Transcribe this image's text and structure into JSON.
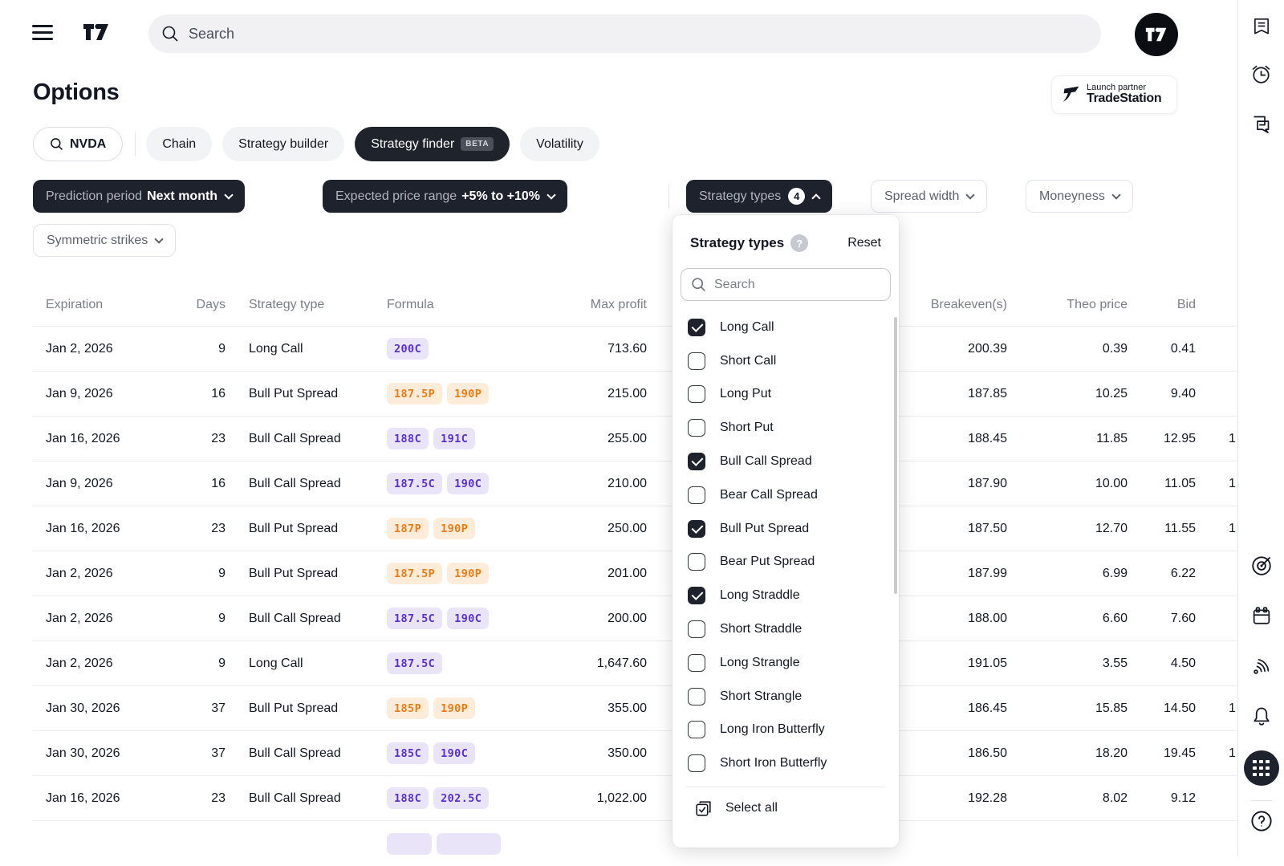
{
  "topbar": {
    "search_placeholder": "Search"
  },
  "page": {
    "title": "Options"
  },
  "partner_badge": {
    "line1": "Launch partner",
    "line2": "TradeStation"
  },
  "symbol_button": {
    "label": "NVDA"
  },
  "tabs": [
    {
      "label": "Chain",
      "active": false
    },
    {
      "label": "Strategy builder",
      "active": false
    },
    {
      "label": "Strategy finder",
      "beta": "BETA",
      "active": true
    },
    {
      "label": "Volatility",
      "active": false
    }
  ],
  "filters": {
    "prediction_period": {
      "label": "Prediction period",
      "value": "Next month"
    },
    "price_range": {
      "label": "Expected price range",
      "value": "+5% to +10%"
    },
    "strategy_types": {
      "label": "Strategy types",
      "count": "4"
    },
    "spread_width": {
      "label": "Spread width"
    },
    "moneyness": {
      "label": "Moneyness"
    },
    "symmetric_strikes": {
      "label": "Symmetric strikes"
    }
  },
  "dropdown": {
    "title": "Strategy types",
    "help_glyph": "?",
    "reset_label": "Reset",
    "search_placeholder": "Search",
    "items": [
      {
        "label": "Long Call",
        "checked": true
      },
      {
        "label": "Short Call",
        "checked": false
      },
      {
        "label": "Long Put",
        "checked": false
      },
      {
        "label": "Short Put",
        "checked": false
      },
      {
        "label": "Bull Call Spread",
        "checked": true
      },
      {
        "label": "Bear Call Spread",
        "checked": false
      },
      {
        "label": "Bull Put Spread",
        "checked": true
      },
      {
        "label": "Bear Put Spread",
        "checked": false
      },
      {
        "label": "Long Straddle",
        "checked": true
      },
      {
        "label": "Short Straddle",
        "checked": false
      },
      {
        "label": "Long Strangle",
        "checked": false
      },
      {
        "label": "Short Strangle",
        "checked": false
      },
      {
        "label": "Long Iron Butterfly",
        "checked": false
      },
      {
        "label": "Short Iron Butterfly",
        "checked": false
      }
    ],
    "select_all_label": "Select all"
  },
  "table": {
    "columns": [
      "Expiration",
      "Days",
      "Strategy type",
      "Formula",
      "Max profit",
      "Breakeven(s)",
      "Theo price",
      "Bid"
    ],
    "rows": [
      {
        "expiration": "Jan 2, 2026",
        "days": "9",
        "strategy": "Long Call",
        "legs": [
          {
            "text": "200C",
            "type": "call"
          }
        ],
        "max_profit": "713.60",
        "breakeven": "200.39",
        "theo": "0.39",
        "bid": "0.41",
        "ask_partial": ""
      },
      {
        "expiration": "Jan 9, 2026",
        "days": "16",
        "strategy": "Bull Put Spread",
        "legs": [
          {
            "text": "187.5P",
            "type": "put"
          },
          {
            "text": "190P",
            "type": "put"
          }
        ],
        "max_profit": "215.00",
        "breakeven": "187.85",
        "theo": "10.25",
        "bid": "9.40",
        "ask_partial": ""
      },
      {
        "expiration": "Jan 16, 2026",
        "days": "23",
        "strategy": "Bull Call Spread",
        "legs": [
          {
            "text": "188C",
            "type": "call"
          },
          {
            "text": "191C",
            "type": "call"
          }
        ],
        "max_profit": "255.00",
        "breakeven": "188.45",
        "theo": "11.85",
        "bid": "12.95",
        "ask_partial": "1"
      },
      {
        "expiration": "Jan 9, 2026",
        "days": "16",
        "strategy": "Bull Call Spread",
        "legs": [
          {
            "text": "187.5C",
            "type": "call"
          },
          {
            "text": "190C",
            "type": "call"
          }
        ],
        "max_profit": "210.00",
        "breakeven": "187.90",
        "theo": "10.00",
        "bid": "11.05",
        "ask_partial": "1"
      },
      {
        "expiration": "Jan 16, 2026",
        "days": "23",
        "strategy": "Bull Put Spread",
        "legs": [
          {
            "text": "187P",
            "type": "put"
          },
          {
            "text": "190P",
            "type": "put"
          }
        ],
        "max_profit": "250.00",
        "breakeven": "187.50",
        "theo": "12.70",
        "bid": "11.55",
        "ask_partial": "1"
      },
      {
        "expiration": "Jan 2, 2026",
        "days": "9",
        "strategy": "Bull Put Spread",
        "legs": [
          {
            "text": "187.5P",
            "type": "put"
          },
          {
            "text": "190P",
            "type": "put"
          }
        ],
        "max_profit": "201.00",
        "breakeven": "187.99",
        "theo": "6.99",
        "bid": "6.22",
        "ask_partial": ""
      },
      {
        "expiration": "Jan 2, 2026",
        "days": "9",
        "strategy": "Bull Call Spread",
        "legs": [
          {
            "text": "187.5C",
            "type": "call"
          },
          {
            "text": "190C",
            "type": "call"
          }
        ],
        "max_profit": "200.00",
        "breakeven": "188.00",
        "theo": "6.60",
        "bid": "7.60",
        "ask_partial": ""
      },
      {
        "expiration": "Jan 2, 2026",
        "days": "9",
        "strategy": "Long Call",
        "legs": [
          {
            "text": "187.5C",
            "type": "call"
          }
        ],
        "max_profit": "1,647.60",
        "breakeven": "191.05",
        "theo": "3.55",
        "bid": "4.50",
        "ask_partial": ""
      },
      {
        "expiration": "Jan 30, 2026",
        "days": "37",
        "strategy": "Bull Put Spread",
        "legs": [
          {
            "text": "185P",
            "type": "put"
          },
          {
            "text": "190P",
            "type": "put"
          }
        ],
        "max_profit": "355.00",
        "breakeven": "186.45",
        "theo": "15.85",
        "bid": "14.50",
        "ask_partial": "1"
      },
      {
        "expiration": "Jan 30, 2026",
        "days": "37",
        "strategy": "Bull Call Spread",
        "legs": [
          {
            "text": "185C",
            "type": "call"
          },
          {
            "text": "190C",
            "type": "call"
          }
        ],
        "max_profit": "350.00",
        "breakeven": "186.50",
        "theo": "18.20",
        "bid": "19.45",
        "ask_partial": "1"
      },
      {
        "expiration": "Jan 16, 2026",
        "days": "23",
        "strategy": "Bull Call Spread",
        "legs": [
          {
            "text": "188C",
            "type": "call"
          },
          {
            "text": "202.5C",
            "type": "call"
          }
        ],
        "max_profit": "1,022.00",
        "breakeven": "192.28",
        "theo": "8.02",
        "bid": "9.12",
        "ask_partial": ""
      }
    ],
    "partial_row": {
      "legs": [
        {
          "text": "",
          "type": "call"
        },
        {
          "text": "",
          "type": "call"
        }
      ]
    }
  },
  "sidebar_icons": {
    "top": [
      "news-icon",
      "alarm-clock-icon",
      "chat-icon"
    ],
    "bottom": [
      "target-icon",
      "calendar-icon",
      "signal-icon",
      "bell-icon",
      "apps-grid-icon",
      "help-icon"
    ]
  },
  "colors": {
    "dark_button": "#1e222d",
    "call_text": "#5a2fd0",
    "call_bg": "#e9e4f8",
    "put_text": "#ee7c15",
    "put_bg": "#fdecd9"
  }
}
